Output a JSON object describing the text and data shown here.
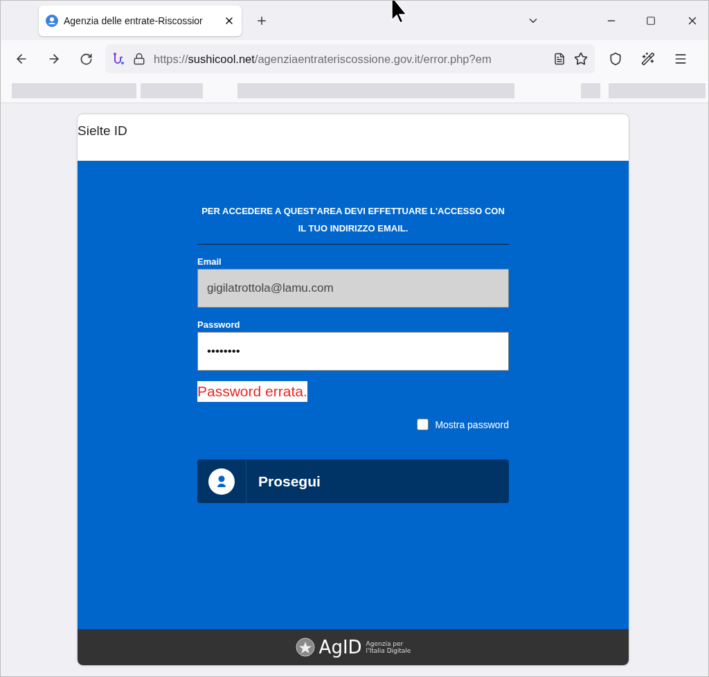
{
  "browser": {
    "tab": {
      "title": "Agenzia delle entrate-Riscossior",
      "selected": true
    },
    "url": {
      "scheme": "https://",
      "host": "sushicool.net",
      "path": "/agenziaentrateriscossione.gov.it/error.php?em"
    }
  },
  "card": {
    "title": "Sielte ID",
    "heading": "PER ACCEDERE A QUEST'AREA DEVI EFFETTUARE L'ACCESSO CON IL TUO INDIRIZZO EMAIL.",
    "fields": [
      {
        "label": "Email",
        "value": "gigilatrottola@lamu.com",
        "disabled": true
      },
      {
        "label": "Password",
        "value": "••••••••",
        "disabled": false
      }
    ],
    "error": "Password errata.",
    "show_password": {
      "label": "Mostra password",
      "checked": false
    },
    "button": "Prosegui",
    "footer": {
      "logo": "AgID",
      "subtitle": [
        "Agenzia per",
        "l'Italia Digitale"
      ]
    }
  }
}
